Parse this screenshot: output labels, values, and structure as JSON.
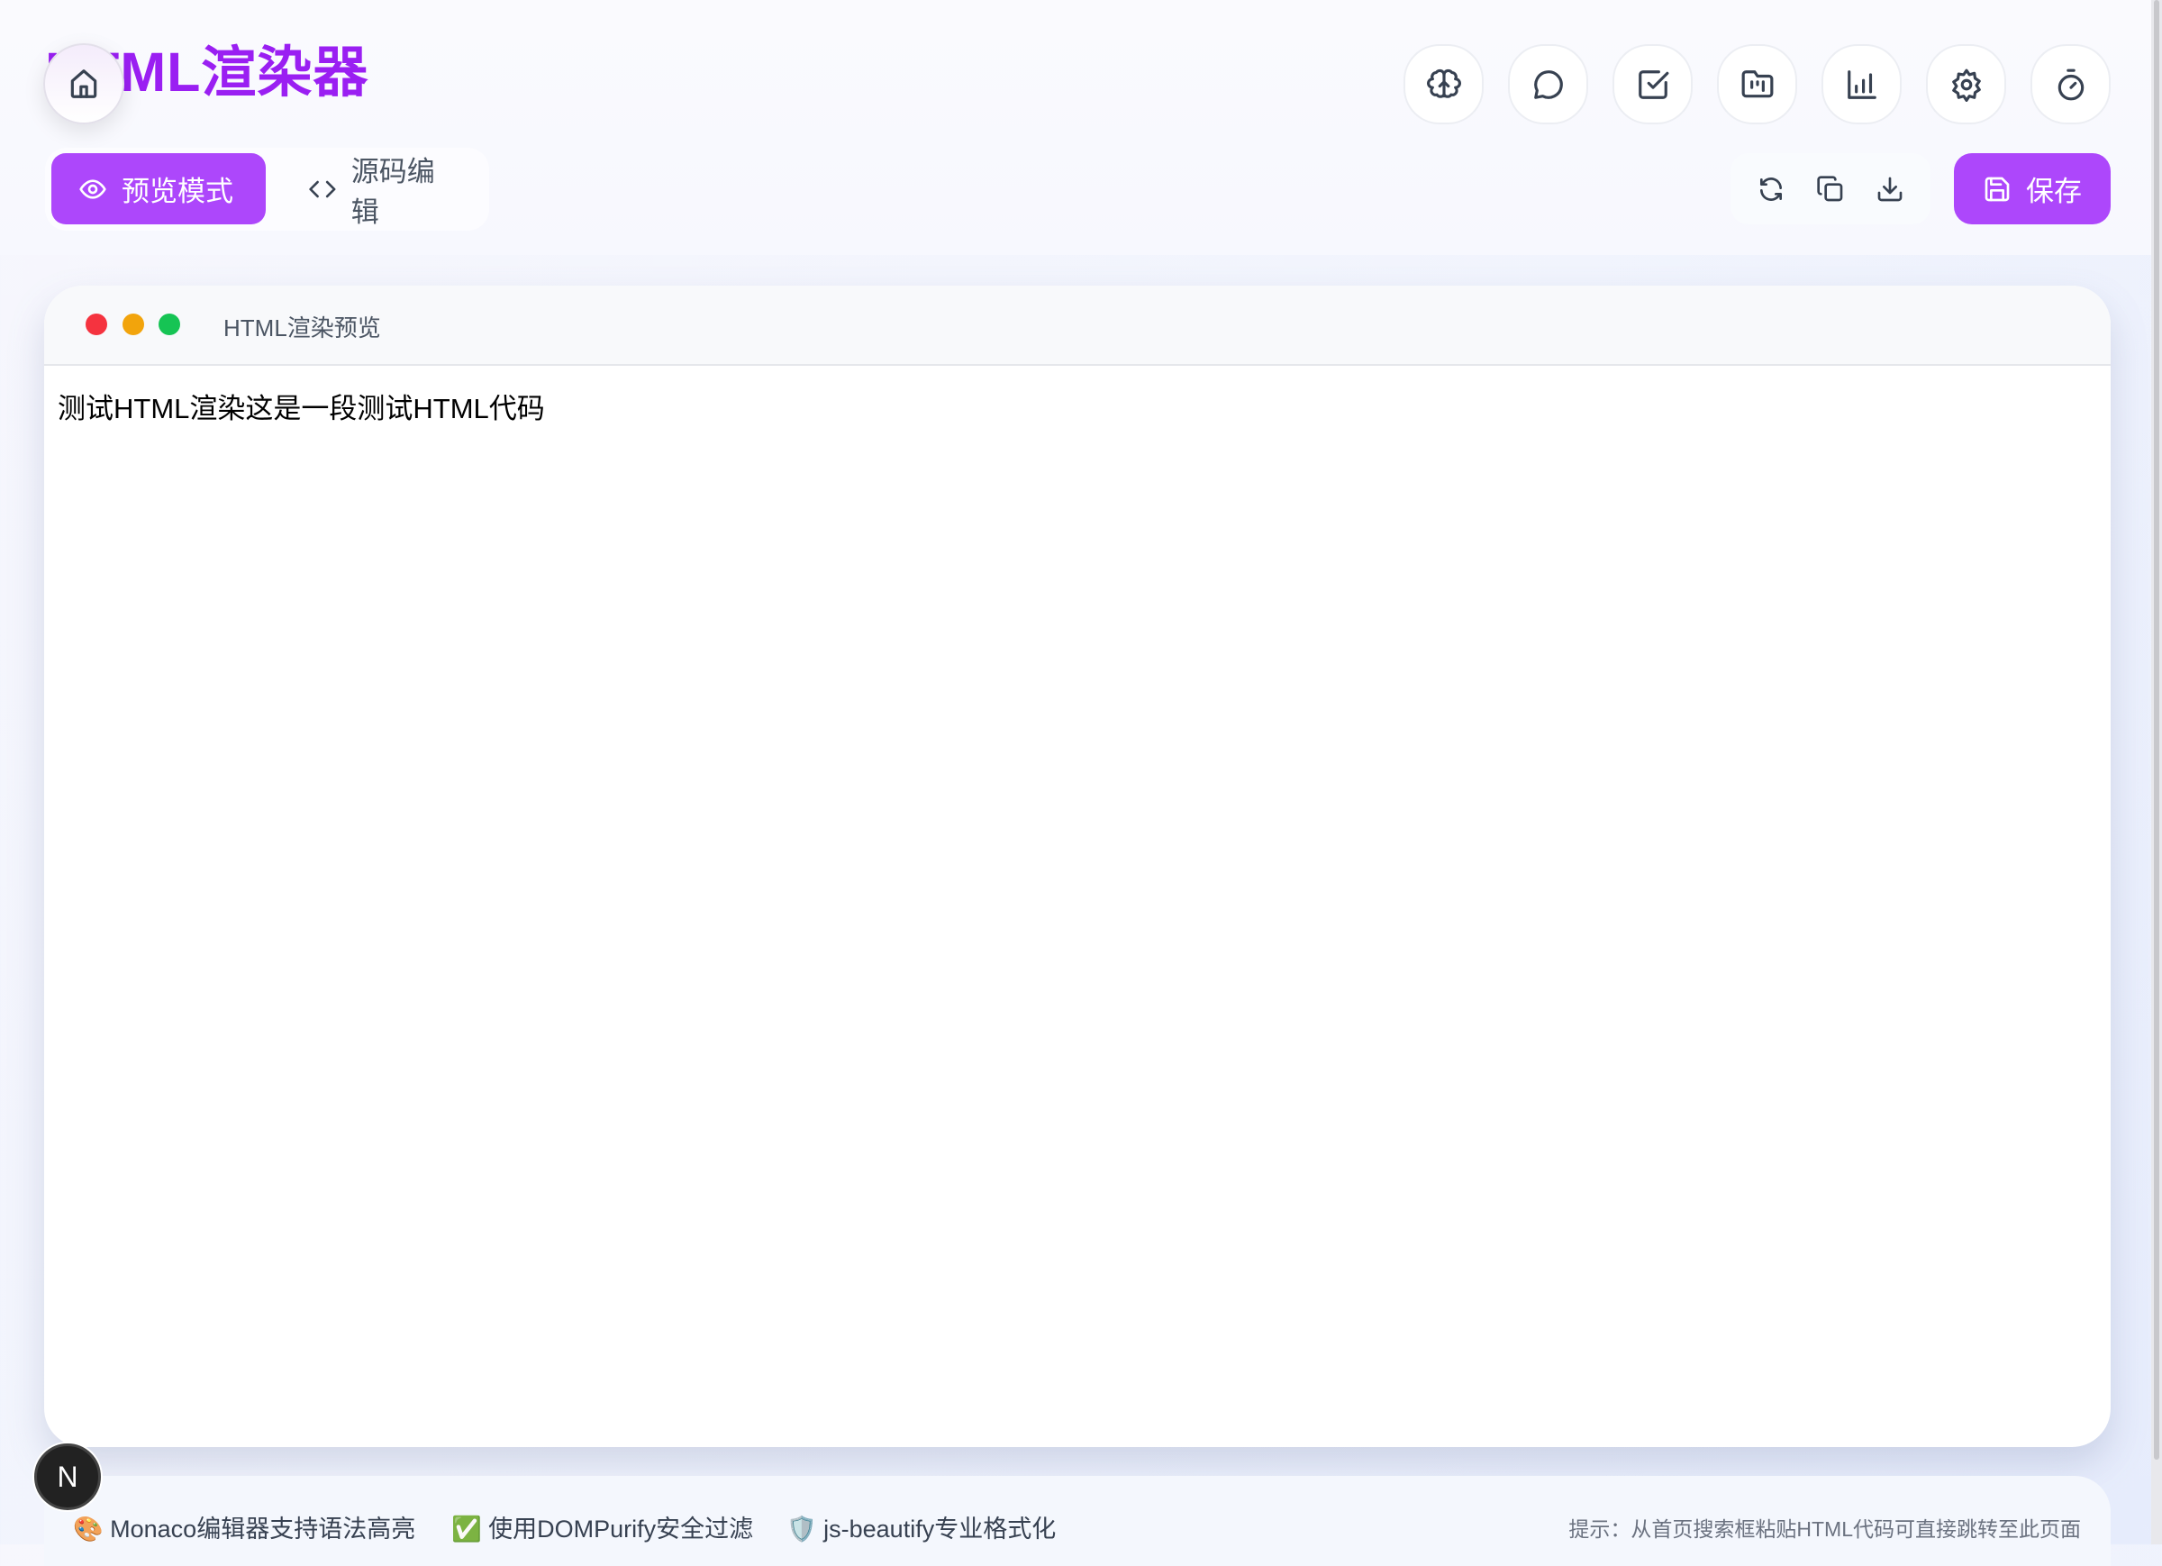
{
  "app": {
    "title": "HTML渲染器"
  },
  "top_nav": [
    {
      "name": "brain-icon"
    },
    {
      "name": "chat-icon"
    },
    {
      "name": "checkbox-icon"
    },
    {
      "name": "folder-kanban-icon"
    },
    {
      "name": "bar-chart-icon"
    },
    {
      "name": "gear-icon"
    },
    {
      "name": "timer-icon"
    }
  ],
  "mode_toggle": {
    "preview": "预览模式",
    "source": "源码编辑"
  },
  "actions": {
    "save": "保存"
  },
  "preview": {
    "window_title": "HTML渲染预览",
    "content": "测试HTML渲染这是一段测试HTML代码",
    "dot_colors": [
      "#f5333f",
      "#f2a40c",
      "#16c454"
    ]
  },
  "footer": {
    "features": [
      {
        "emoji": "🎨",
        "text": "Monaco编辑器支持语法高亮"
      },
      {
        "emoji": "✅",
        "text": "使用DOMPurify安全过滤"
      },
      {
        "emoji": "🛡️",
        "text": "js-beautify专业格式化"
      }
    ],
    "hint": "提示：从首页搜索框粘贴HTML代码可直接跳转至此页面"
  },
  "badge": {
    "letter": "N"
  },
  "colors": {
    "accent": "#ad47fb",
    "title": "#9a1ff2"
  }
}
